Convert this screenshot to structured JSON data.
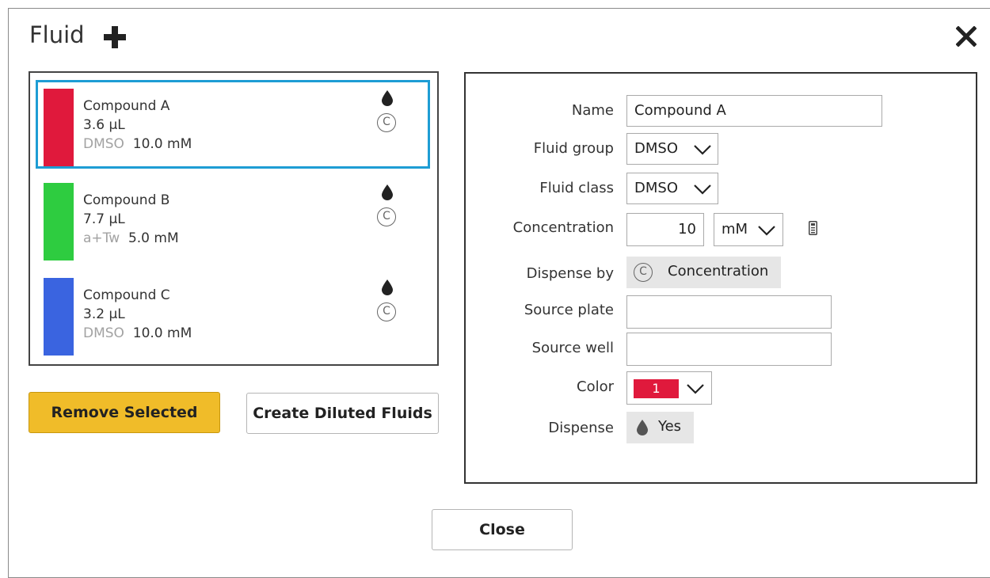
{
  "dialog": {
    "title": "Fluid",
    "add_icon": "plus-icon",
    "close_icon": "close-x-icon"
  },
  "fluids": [
    {
      "name": "Compound A",
      "volume": "3.6 µL",
      "group": "DMSO",
      "concentration": "10.0 mM",
      "color": "#e0193c",
      "selected": true
    },
    {
      "name": "Compound B",
      "volume": "7.7 µL",
      "group": "a+Tw",
      "concentration": "5.0 mM",
      "color": "#2ecc40",
      "selected": false
    },
    {
      "name": "Compound C",
      "volume": "3.2 µL",
      "group": "DMSO",
      "concentration": "10.0 mM",
      "color": "#3a64e0",
      "selected": false
    }
  ],
  "list_icons": {
    "dispense": "droplet-icon",
    "dispense_by": "c-circle-icon",
    "c_glyph": "C"
  },
  "buttons": {
    "remove_selected": "Remove Selected",
    "create_diluted": "Create Diluted Fluids",
    "close": "Close"
  },
  "form": {
    "name_label": "Name",
    "name_value": "Compound A",
    "fluid_group_label": "Fluid group",
    "fluid_group_value": "DMSO",
    "fluid_class_label": "Fluid class",
    "fluid_class_value": "DMSO",
    "concentration_label": "Concentration",
    "concentration_value": "10",
    "concentration_unit": "mM",
    "dispense_by_label": "Dispense by",
    "dispense_by_value": "Concentration",
    "source_plate_label": "Source plate",
    "source_plate_value": "",
    "source_well_label": "Source well",
    "source_well_value": "",
    "color_label": "Color",
    "color_value": "1",
    "color_hex": "#e0193c",
    "dispense_label": "Dispense",
    "dispense_value": "Yes"
  }
}
